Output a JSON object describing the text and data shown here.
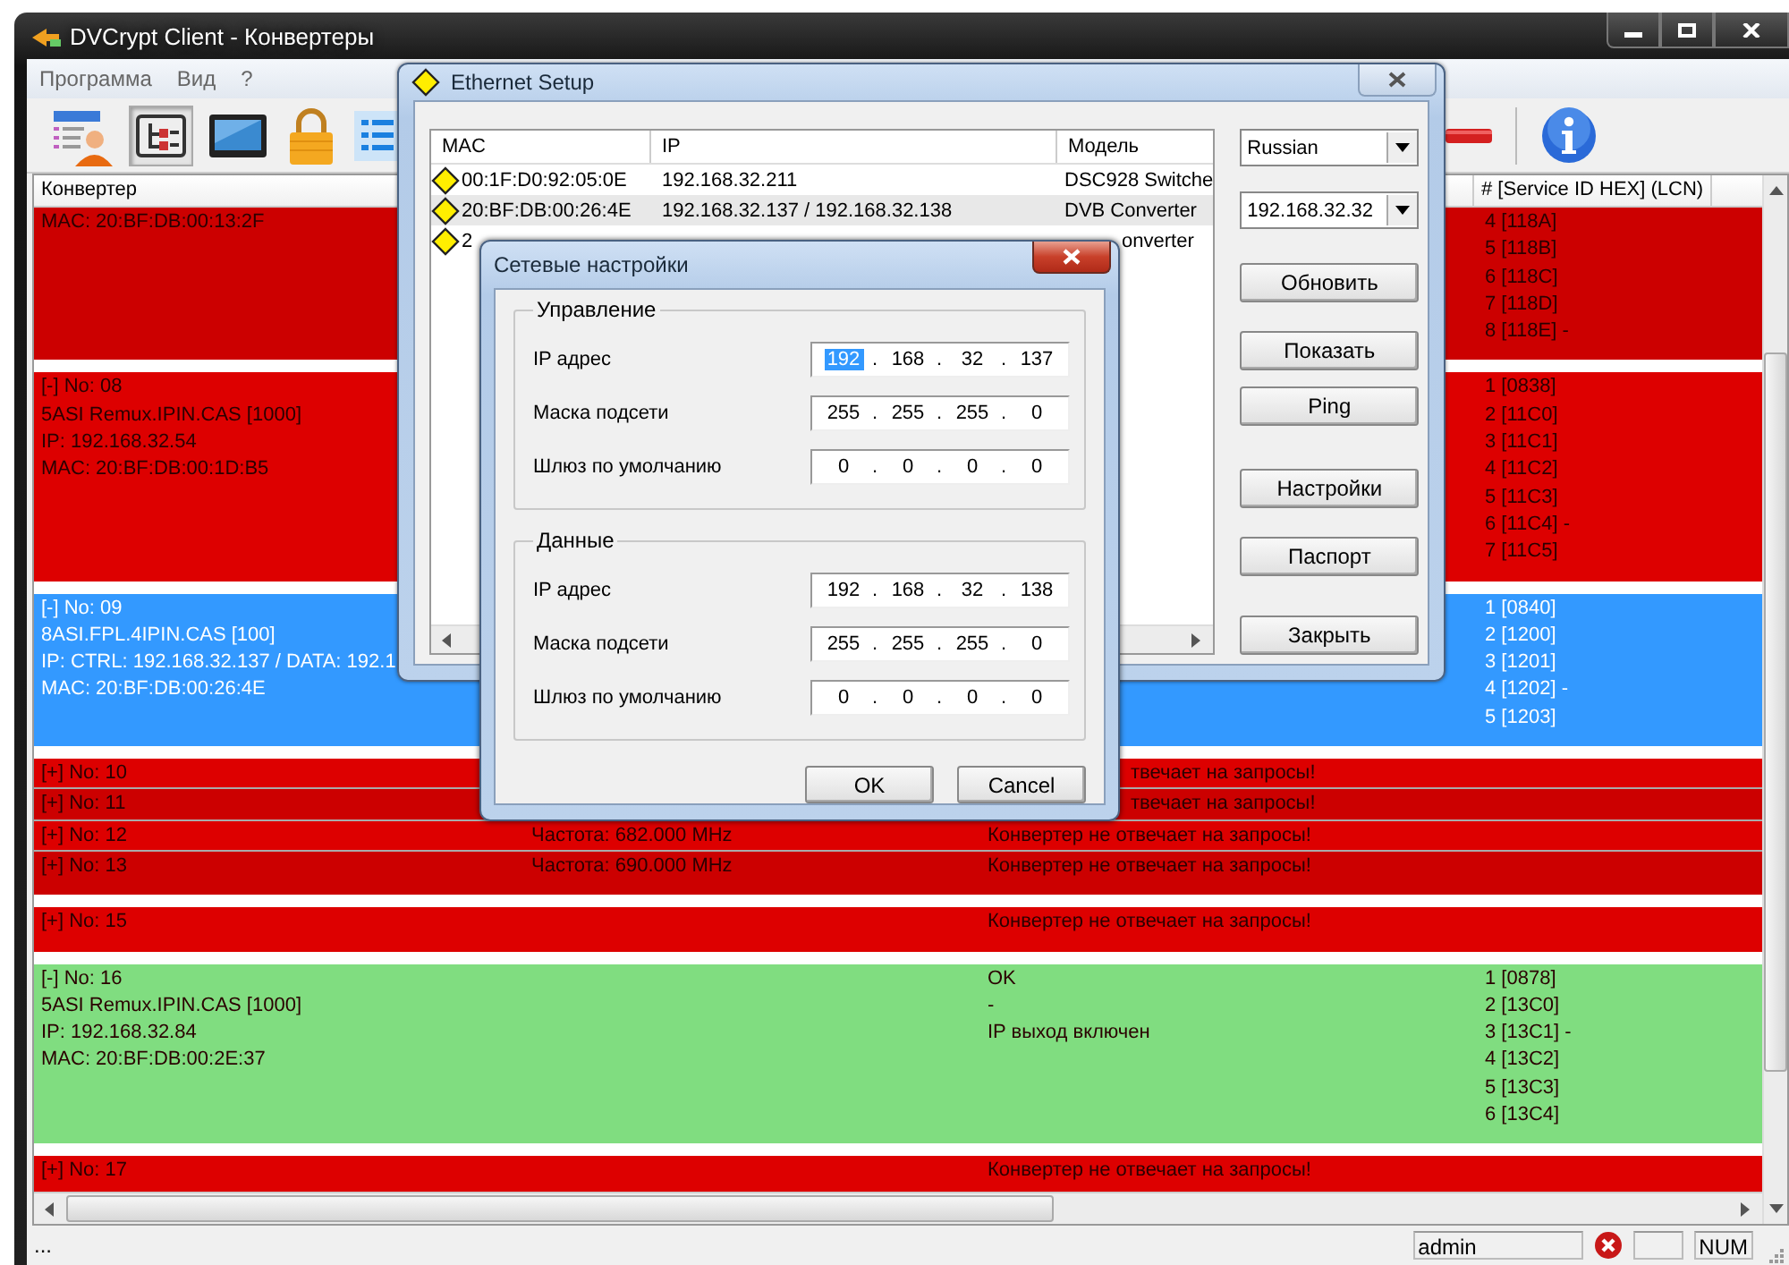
{
  "window": {
    "title": "DVCrypt Client - Конвертеры"
  },
  "menu": [
    {
      "label": "Программа"
    },
    {
      "label": "Вид"
    },
    {
      "label": "?"
    }
  ],
  "toolbar": [
    {
      "kind": "user-list",
      "pressed": false
    },
    {
      "kind": "tree",
      "pressed": true
    },
    {
      "kind": "monitor",
      "pressed": false
    },
    {
      "kind": "lock",
      "pressed": false
    },
    {
      "kind": "list",
      "pressed": false
    },
    {
      "kind": "red-bar",
      "pressed": false
    },
    {
      "kind": "info",
      "pressed": false
    }
  ],
  "converter_list": {
    "columns": [
      {
        "label": "Конвертер"
      },
      {
        "label": "# [Service ID HEX] (LCN)"
      }
    ],
    "blocks": [
      {
        "rows": [
          {
            "selected": false,
            "color": "#cc0000",
            "converter": [
              "MAC: 20:BF:DB:00:13:2F"
            ],
            "services": [
              "4 [118A]",
              "5 [118B]",
              "6 [118C]",
              "7 [118D]",
              "8 [118E] -"
            ]
          }
        ]
      },
      {
        "rows": [
          {
            "selected": false,
            "color": "#dd0000",
            "converter": [
              "[-] No: 08",
              "5ASI Remux.IPIN.CAS [1000]",
              "IP: 192.168.32.54",
              "MAC: 20:BF:DB:00:1D:B5"
            ],
            "services": [
              "1 [0838]",
              "2 [11C0]",
              "3 [11C1]",
              "4 [11C2]",
              "5 [11C3]",
              "6 [11C4] -",
              "7 [11C5]"
            ]
          }
        ]
      },
      {
        "rows": [
          {
            "selected": true,
            "converter": [
              "[-] No: 09",
              "8ASI.FPL.4IPIN.CAS [100]",
              "IP: CTRL: 192.168.32.137 / DATA: 192.1",
              "MAC: 20:BF:DB:00:26:4E"
            ],
            "services": [
              "1 [0840]",
              "2 [1200]",
              "3 [1201]",
              "4 [1202] -",
              "5 [1203]"
            ]
          }
        ]
      },
      {
        "rows": [
          {
            "selected": false,
            "under_dialog": true,
            "color": "#dd0000",
            "converter": [
              "[+] No: 10"
            ],
            "column_3": [
              "твечает на запросы!"
            ]
          },
          {
            "selected": false,
            "under_dialog": true,
            "color": "#cc0000",
            "converter": [
              "[+] No: 11"
            ],
            "column_3": [
              "твечает на запросы!"
            ]
          },
          {
            "selected": false,
            "color": "#dd0000",
            "converter": [
              "[+] No: 12"
            ],
            "column_2": [
              "Частота: 682.000 MHz"
            ],
            "column_3": [
              "Конвертер не отвечает на запросы!"
            ]
          },
          {
            "selected": false,
            "color": "#cc0000",
            "converter": [
              "[+] No: 13"
            ],
            "column_2": [
              "Частота: 690.000 MHz"
            ],
            "column_3": [
              "Конвертер не отвечает на запросы!"
            ]
          }
        ]
      },
      {
        "rows": [
          {
            "selected": false,
            "color": "#dd0000",
            "converter": [
              "[+] No: 15"
            ],
            "column_3": [
              "Конвертер не отвечает на запросы!"
            ]
          }
        ]
      },
      {
        "rows": [
          {
            "selected": false,
            "color": "#80dd80",
            "converter": [
              "[-] No: 16",
              "5ASI Remux.IPIN.CAS [1000]",
              "IP: 192.168.32.84",
              "MAC: 20:BF:DB:00:2E:37"
            ],
            "column_3": [
              "OK",
              "-",
              "IP выход включен"
            ],
            "services": [
              "1 [0878]",
              "2 [13C0]",
              "3 [13C1] -",
              "4 [13C2]",
              "5 [13C3]",
              "6 [13C4]"
            ]
          }
        ]
      },
      {
        "rows": [
          {
            "selected": false,
            "color": "#dd0000",
            "converter": [
              "[+] No: 17"
            ],
            "column_3": [
              "Конвертер не отвечает на запросы!"
            ]
          }
        ]
      }
    ]
  },
  "status_bar": {
    "text": "...",
    "user": "admin",
    "indicator": "NUM"
  },
  "ethernet_setup": {
    "title": "Ethernet Setup",
    "columns": [
      "MAC",
      "IP",
      "Модель"
    ],
    "rows": [
      {
        "mac": "00:1F:D0:92:05:0E",
        "ip": "192.168.32.211",
        "model": "DSC928 Switche",
        "selected": false
      },
      {
        "mac": "20:BF:DB:00:26:4E",
        "ip": "192.168.32.137 / 192.168.32.138",
        "model": "DVB Converter",
        "selected": true
      },
      {
        "mac": "2",
        "model": "onverter",
        "selected": false,
        "under_dialog": true
      }
    ],
    "dropdowns": [
      {
        "value": "Russian"
      },
      {
        "value": "192.168.32.32"
      }
    ],
    "buttons": [
      "Обновить",
      "Показать",
      "Ping",
      "Настройки",
      "Паспорт",
      "Закрыть"
    ]
  },
  "network_settings": {
    "title": "Сетевые настройки",
    "groups": [
      {
        "title": "Управление",
        "fields": [
          {
            "label": "IP адрес",
            "parts": [
              {
                "text": "192",
                "selected": true
              },
              {
                "text": ".",
                "selected": false
              },
              {
                "text": "168",
                "selected": false
              },
              {
                "text": ".",
                "selected": false
              },
              {
                "text": "32",
                "selected": false
              },
              {
                "text": ".",
                "selected": false
              },
              {
                "text": "137",
                "selected": false
              }
            ]
          },
          {
            "label": "Маска подсети",
            "parts": [
              {
                "text": "255",
                "selected": false
              },
              {
                "text": ".",
                "selected": false
              },
              {
                "text": "255",
                "selected": false
              },
              {
                "text": ".",
                "selected": false
              },
              {
                "text": "255",
                "selected": false
              },
              {
                "text": ".",
                "selected": false
              },
              {
                "text": "0",
                "selected": false
              }
            ]
          },
          {
            "label": "Шлюз по умолчанию",
            "parts": [
              {
                "text": "0",
                "selected": false
              },
              {
                "text": ".",
                "selected": false
              },
              {
                "text": "0",
                "selected": false
              },
              {
                "text": ".",
                "selected": false
              },
              {
                "text": "0",
                "selected": false
              },
              {
                "text": ".",
                "selected": false
              },
              {
                "text": "0",
                "selected": false
              }
            ]
          }
        ]
      },
      {
        "title": "Данные",
        "fields": [
          {
            "label": "IP адрес",
            "parts": [
              {
                "text": "192",
                "selected": false
              },
              {
                "text": ".",
                "selected": false
              },
              {
                "text": "168",
                "selected": false
              },
              {
                "text": ".",
                "selected": false
              },
              {
                "text": "32",
                "selected": false
              },
              {
                "text": ".",
                "selected": false
              },
              {
                "text": "138",
                "selected": false
              }
            ]
          },
          {
            "label": "Маска подсети",
            "parts": [
              {
                "text": "255",
                "selected": false
              },
              {
                "text": ".",
                "selected": false
              },
              {
                "text": "255",
                "selected": false
              },
              {
                "text": ".",
                "selected": false
              },
              {
                "text": "255",
                "selected": false
              },
              {
                "text": ".",
                "selected": false
              },
              {
                "text": "0",
                "selected": false
              }
            ]
          },
          {
            "label": "Шлюз по умолчанию",
            "parts": [
              {
                "text": "0",
                "selected": false
              },
              {
                "text": ".",
                "selected": false
              },
              {
                "text": "0",
                "selected": false
              },
              {
                "text": ".",
                "selected": false
              },
              {
                "text": "0",
                "selected": false
              },
              {
                "text": ".",
                "selected": false
              },
              {
                "text": "0",
                "selected": false
              }
            ]
          }
        ]
      }
    ],
    "buttons": [
      "OK",
      "Cancel"
    ]
  }
}
